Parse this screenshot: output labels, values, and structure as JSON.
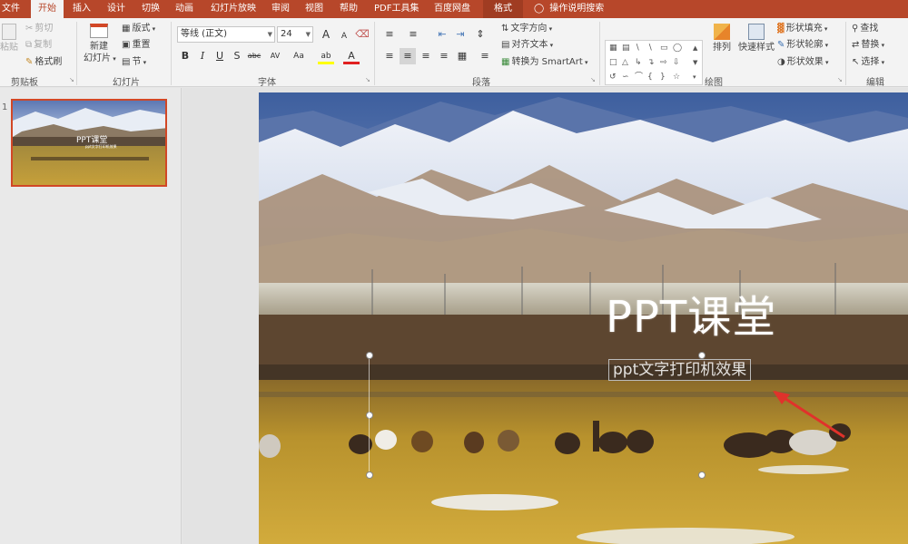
{
  "tabs": [
    {
      "label": "文件"
    },
    {
      "label": "开始"
    },
    {
      "label": "插入"
    },
    {
      "label": "设计"
    },
    {
      "label": "切换"
    },
    {
      "label": "动画"
    },
    {
      "label": "幻灯片放映"
    },
    {
      "label": "审阅"
    },
    {
      "label": "视图"
    },
    {
      "label": "帮助"
    },
    {
      "label": "PDF工具集"
    },
    {
      "label": "百度网盘"
    },
    {
      "label": "格式"
    }
  ],
  "tell_me": "操作说明搜索",
  "clipboard": {
    "paste": "粘贴",
    "cut": "剪切",
    "copy": "复制",
    "format_painter": "格式刷",
    "label": "剪贴板"
  },
  "slides_group": {
    "new_slide": "新建",
    "new_slide2": "幻灯片",
    "layout": "版式",
    "reset": "重置",
    "section": "节",
    "label": "幻灯片"
  },
  "font": {
    "family": "等线 (正文)",
    "size": "24",
    "label": "字体",
    "bold": "B",
    "italic": "I",
    "underline": "U",
    "shadow": "S",
    "strike": "abc",
    "spacing": "AV",
    "case": "Aa",
    "highlight": "ab",
    "color": "A",
    "grow": "A",
    "shrink": "A"
  },
  "paragraph": {
    "text_direction": "文字方向",
    "align_text": "对齐文本",
    "smartart": "转换为 SmartArt",
    "label": "段落"
  },
  "drawing": {
    "arrange": "排列",
    "quick_styles": "快速样式",
    "fill": "形状填充",
    "outline": "形状轮廓",
    "effects": "形状效果",
    "label": "绘图"
  },
  "editing": {
    "find": "查找",
    "replace": "替换",
    "select": "选择",
    "label": "编辑"
  },
  "thumbnail": {
    "number": "1",
    "title": "PPT课堂",
    "subtitle": "ppt文字打印机效果"
  },
  "slide": {
    "title": "PPT课堂",
    "subtitle": "ppt文字打印机效果"
  },
  "colors": {
    "accent": "#b7472a",
    "selected_border": "#d24726",
    "annotation_arrow": "#e0322b"
  }
}
